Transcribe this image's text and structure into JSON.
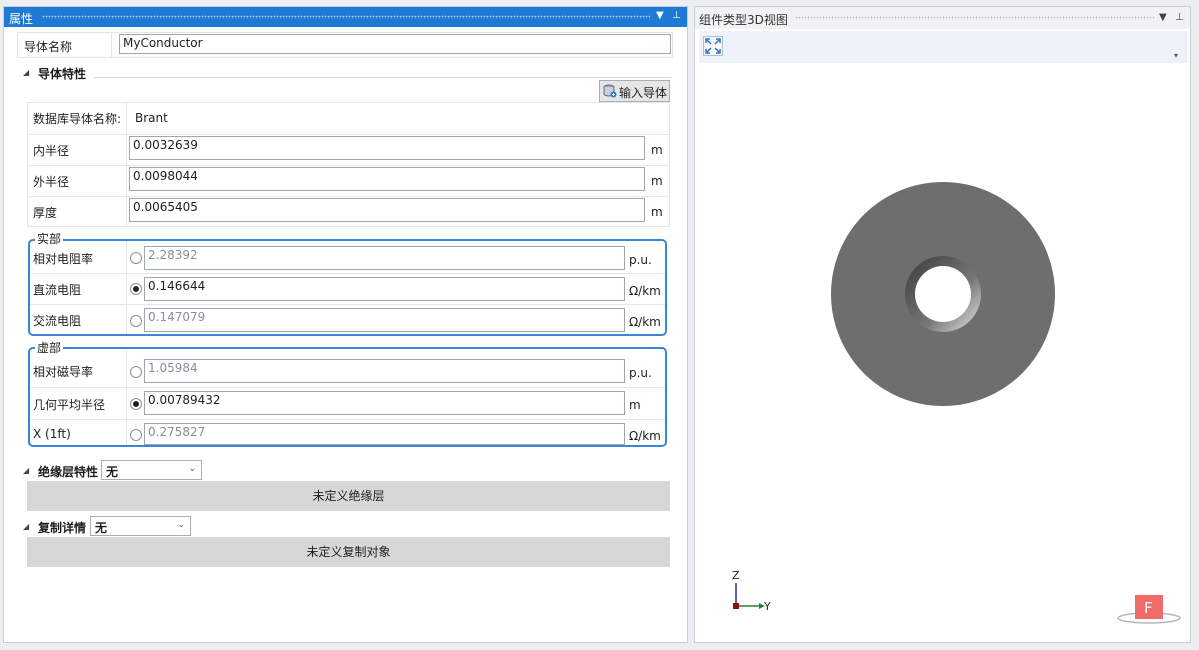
{
  "left_panel": {
    "title": "属性",
    "pin_icon": "pin-icon",
    "dropdown_icon": "chevron-down-icon"
  },
  "conductor_name": {
    "label": "导体名称",
    "value": "MyConductor"
  },
  "conductor_section": {
    "header": "导体特性",
    "import_button": "输入导体",
    "rows": [
      {
        "label": "数据库导体名称:",
        "value": "Brant",
        "unit": ""
      },
      {
        "label": "内半径",
        "value": "0.0032639",
        "unit": "m"
      },
      {
        "label": "外半径",
        "value": "0.0098044",
        "unit": "m"
      },
      {
        "label": "厚度",
        "value": "0.0065405",
        "unit": "m"
      }
    ]
  },
  "real_group": {
    "legend": "实部",
    "rows": [
      {
        "label": "相对电阻率",
        "value": "2.28392",
        "unit": "p.u.",
        "selected": false
      },
      {
        "label": "直流电阻",
        "value": "0.146644",
        "unit": "Ω/km",
        "selected": true
      },
      {
        "label": "交流电阻",
        "value": "0.147079",
        "unit": "Ω/km",
        "selected": false
      }
    ]
  },
  "imag_group": {
    "legend": "虚部",
    "rows": [
      {
        "label": "相对磁导率",
        "value": "1.05984",
        "unit": "p.u.",
        "selected": false
      },
      {
        "label": "几何平均半径",
        "value": "0.00789432",
        "unit": "m",
        "selected": true
      },
      {
        "label": "X (1ft)",
        "value": "0.275827",
        "unit": "Ω/km",
        "selected": false
      }
    ]
  },
  "insulation": {
    "header": "绝缘层特性",
    "combo_value": "无",
    "bar_text": "未定义绝缘层"
  },
  "copy_detail": {
    "header": "复制详情",
    "combo_value": "无",
    "bar_text": "未定义复制对象"
  },
  "right_panel": {
    "title": "组件类型3D视图",
    "fit_icon": "fit-view-icon",
    "axis_z": "Z",
    "axis_y": "Y",
    "front_marker": "F",
    "colors": {
      "ring": "#6e6e6e",
      "accent": "#1f7ad6",
      "front": "#f26b6b"
    }
  }
}
